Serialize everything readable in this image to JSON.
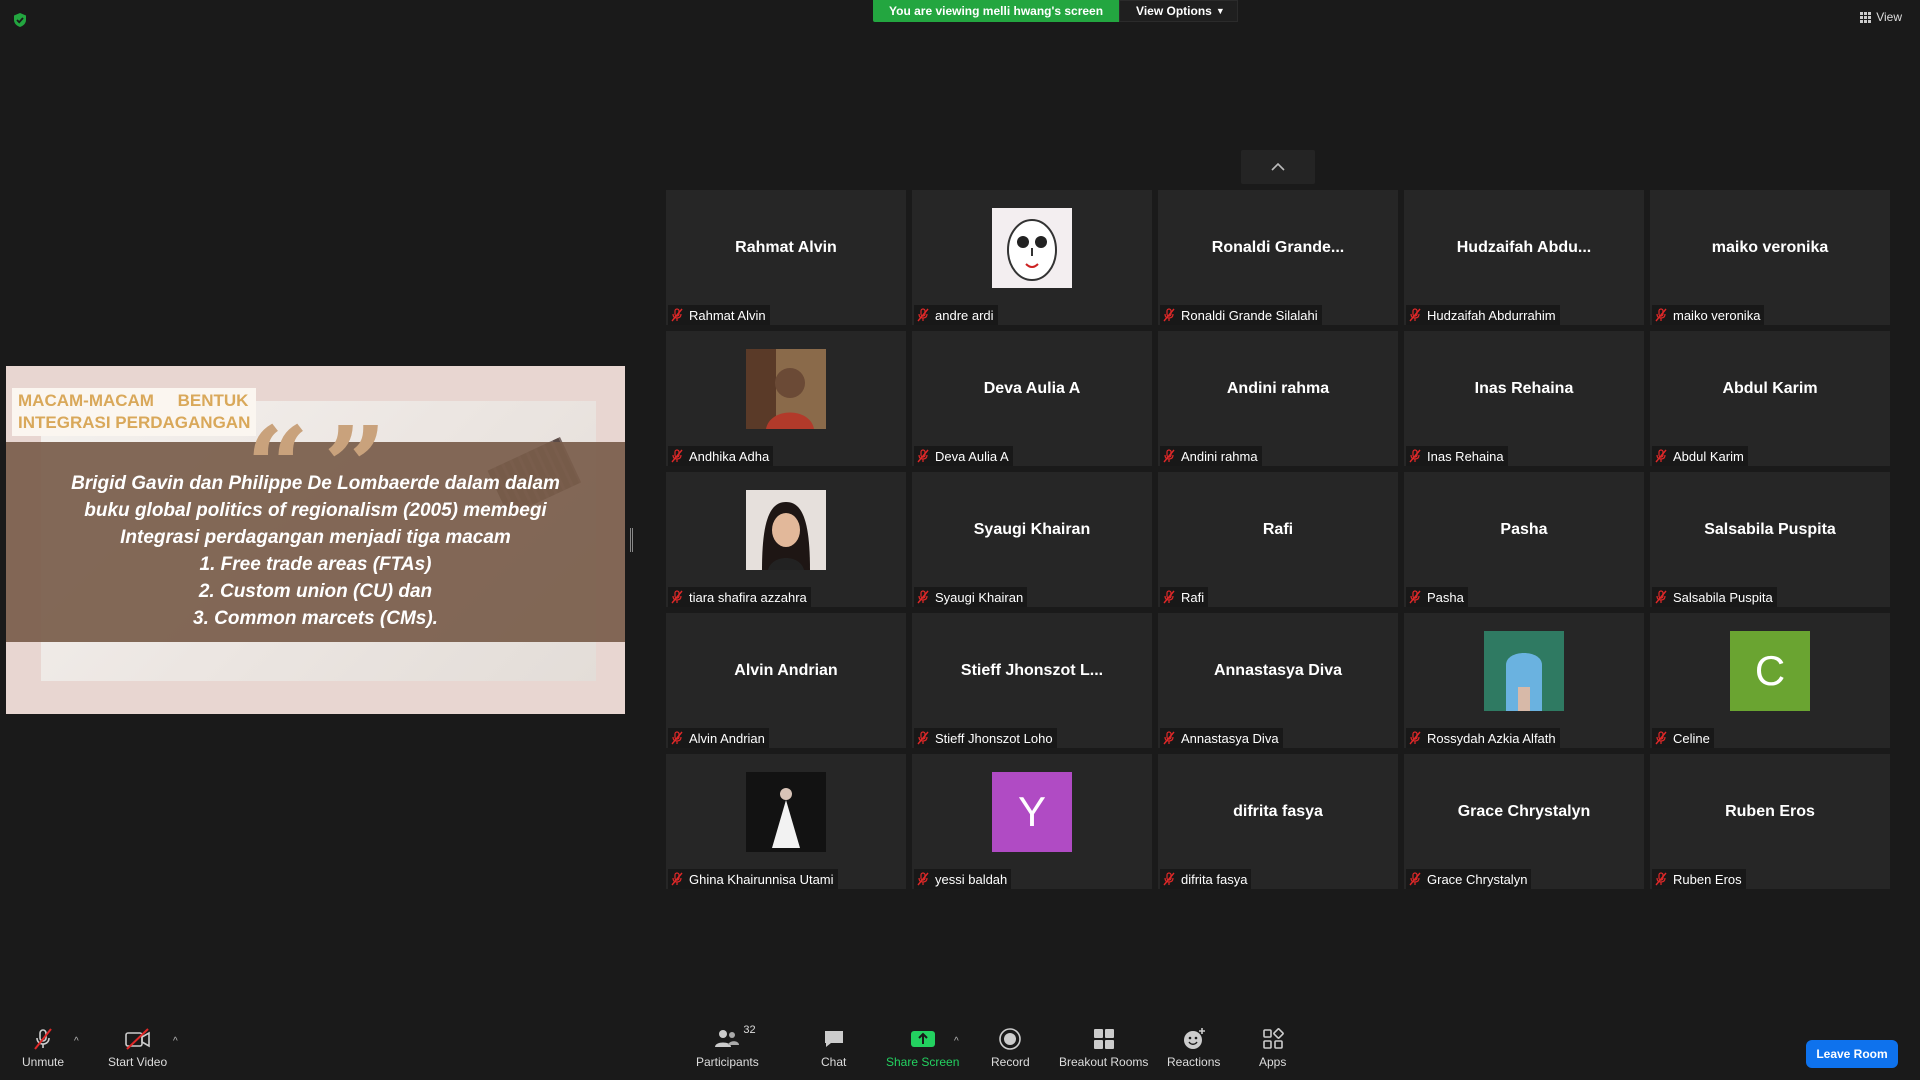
{
  "banner": {
    "viewing": "You are viewing melli hwang's screen",
    "view_options": "View Options"
  },
  "view_label": "View",
  "shared_slide": {
    "title_line1": "MACAM-MACAM     BENTUK",
    "title_line2": "INTEGRASI PERDAGANGAN",
    "quote_marks": "“”",
    "line1": "Brigid Gavin dan Philippe De Lombaerde dalam dalam",
    "line2": "buku global politics of regionalism (2005) membegi",
    "line3": "Integrasi perdagangan menjadi tiga macam",
    "line4": "1. Free trade areas (FTAs)",
    "line5": "2. Custom union (CU) dan",
    "line6": "3. Common marcets (CMs)."
  },
  "participants": [
    {
      "center": "Rahmat Alvin",
      "label": "Rahmat Alvin",
      "avatar": ""
    },
    {
      "center": "",
      "label": "andre ardi",
      "avatar": "drawing-face"
    },
    {
      "center": "Ronaldi  Grande...",
      "label": "Ronaldi Grande Silalahi",
      "avatar": ""
    },
    {
      "center": "Hudzaifah  Abdu...",
      "label": "Hudzaifah Abdurrahim",
      "avatar": ""
    },
    {
      "center": "maiko veronika",
      "label": "maiko veronika",
      "avatar": ""
    },
    {
      "center": "",
      "label": "Andhika Adha",
      "avatar": "photo-man"
    },
    {
      "center": "Deva Aulia A",
      "label": "Deva Aulia A",
      "avatar": ""
    },
    {
      "center": "Andini rahma",
      "label": "Andini rahma",
      "avatar": ""
    },
    {
      "center": "Inas Rehaina",
      "label": "Inas Rehaina",
      "avatar": ""
    },
    {
      "center": "Abdul Karim",
      "label": "Abdul Karim",
      "avatar": ""
    },
    {
      "center": "",
      "label": "tiara shafira azzahra",
      "avatar": "photo-girl"
    },
    {
      "center": "Syaugi Khairan",
      "label": "Syaugi Khairan",
      "avatar": ""
    },
    {
      "center": "Rafi",
      "label": "Rafi",
      "avatar": ""
    },
    {
      "center": "Pasha",
      "label": "Pasha",
      "avatar": ""
    },
    {
      "center": "Salsabila Puspita",
      "label": "Salsabila Puspita",
      "avatar": ""
    },
    {
      "center": "Alvin Andrian",
      "label": "Alvin Andrian",
      "avatar": ""
    },
    {
      "center": "Stieff  Jhonszot  L...",
      "label": "Stieff Jhonszot Loho",
      "avatar": ""
    },
    {
      "center": "Annastasya Diva",
      "label": "Annastasya Diva",
      "avatar": ""
    },
    {
      "center": "",
      "label": "Rossydah Azkia Alfath",
      "avatar": "photo-arch"
    },
    {
      "center": "",
      "label": "Celine",
      "avatar": "letter",
      "letter": "C",
      "color": "#6aa431"
    },
    {
      "center": "",
      "label": "Ghina Khairunnisa Utami",
      "avatar": "photo-dress"
    },
    {
      "center": "",
      "label": "yessi baldah",
      "avatar": "letter",
      "letter": "Y",
      "color": "#b04bc4"
    },
    {
      "center": "difrita fasya",
      "label": "difrita fasya",
      "avatar": ""
    },
    {
      "center": "Grace Chrystalyn",
      "label": "Grace Chrystalyn",
      "avatar": ""
    },
    {
      "center": "Ruben Eros",
      "label": "Ruben Eros",
      "avatar": ""
    }
  ],
  "toolbar": {
    "unmute": "Unmute",
    "start_video": "Start Video",
    "participants": "Participants",
    "participant_count": "32",
    "chat": "Chat",
    "share_screen": "Share Screen",
    "record": "Record",
    "breakout_rooms": "Breakout Rooms",
    "reactions": "Reactions",
    "apps": "Apps",
    "leave": "Leave Room"
  },
  "colors": {
    "accent_green": "#23a640",
    "leave_blue": "#0e72ed",
    "mic_red": "#e02828"
  }
}
